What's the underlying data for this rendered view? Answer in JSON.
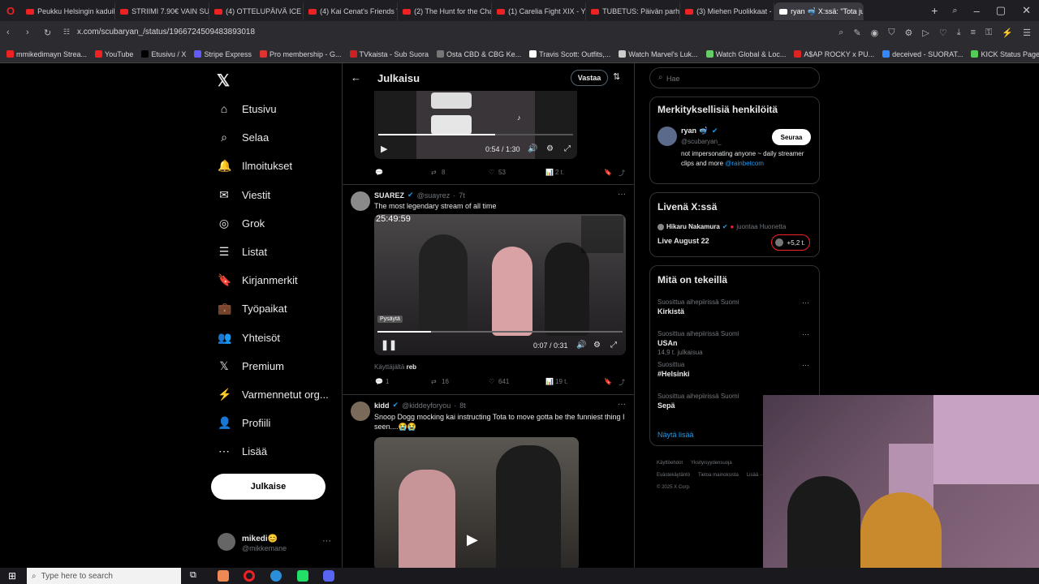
{
  "browser": {
    "tabs": [
      {
        "label": "Peukku Helsingin kaduill..."
      },
      {
        "label": "STRIIMI 7.90€ VAIN SUNN..."
      },
      {
        "label": "(4) OTTELUPÄIVÄ ICE CAG..."
      },
      {
        "label": "(4) Kai Cenat's Friends W..."
      },
      {
        "label": "(2) The Hunt for the Char..."
      },
      {
        "label": "(1) Carelia Fight XIX - You..."
      },
      {
        "label": "TUBETUS: Päivän parhaat..."
      },
      {
        "label": "(3) Miehen Puolikkaat - Yo..."
      },
      {
        "label": "ryan 🤿 X:ssä: \"Tota ju..."
      }
    ],
    "url": "x.com/scubaryan_/status/1966724509483893018",
    "bookmarks": [
      {
        "label": "mmikedimayn Strea...",
        "color": "#e22"
      },
      {
        "label": "YouTube",
        "color": "#e22"
      },
      {
        "label": "Etusivu / X",
        "color": "#000"
      },
      {
        "label": "Stripe Express",
        "color": "#635bff"
      },
      {
        "label": "Pro membership - G...",
        "color": "#d33"
      },
      {
        "label": "TVkaista - Sub Suora",
        "color": "#c22"
      },
      {
        "label": "Osta CBD & CBG Ke...",
        "color": "#777"
      },
      {
        "label": "Travis Scott: Outfits,...",
        "color": "#fff"
      },
      {
        "label": "Watch Marvel's Luk...",
        "color": "#ccc"
      },
      {
        "label": "Watch Global & Loc...",
        "color": "#6c6"
      },
      {
        "label": "A$AP ROCKY x PU...",
        "color": "#d22"
      },
      {
        "label": "deceived - SUORAT...",
        "color": "#38f"
      },
      {
        "label": "KICK Status Page",
        "color": "#5c5"
      }
    ]
  },
  "nav": {
    "items": [
      {
        "label": "Etusivu",
        "icon": "⌂"
      },
      {
        "label": "Selaa",
        "icon": "⌕"
      },
      {
        "label": "Ilmoitukset",
        "icon": "🔔"
      },
      {
        "label": "Viestit",
        "icon": "✉"
      },
      {
        "label": "Grok",
        "icon": "◎"
      },
      {
        "label": "Listat",
        "icon": "☰"
      },
      {
        "label": "Kirjanmerkit",
        "icon": "🔖"
      },
      {
        "label": "Työpaikat",
        "icon": "💼"
      },
      {
        "label": "Yhteisöt",
        "icon": "👥"
      },
      {
        "label": "Premium",
        "icon": "𝕏"
      },
      {
        "label": "Varmennetut org...",
        "icon": "⚡"
      },
      {
        "label": "Profiili",
        "icon": "👤"
      },
      {
        "label": "Lisää",
        "icon": "⋯"
      }
    ],
    "post_button": "Julkaise",
    "account": {
      "name": "mikedi😊",
      "handle": "@mikkemane"
    }
  },
  "center": {
    "header_title": "Julkaisu",
    "reply_button": "Vastaa",
    "top_video": {
      "time": "0:54 / 1:30",
      "progress": 0.6
    },
    "top_actions": {
      "retweets": "8",
      "likes": "53",
      "views": "2 t."
    },
    "post1": {
      "name": "SUAREZ",
      "handle": "@suayrez",
      "time": "7t",
      "text": "The most legendary stream of all time",
      "video_overlay": "25:49:59",
      "video_tooltip": "Pysäytä",
      "video_time": "0:07 / 0:31",
      "video_progress": 0.22,
      "from_user_prefix": "Käyttäjältä",
      "from_user": "reb",
      "replies": "1",
      "retweets": "16",
      "likes": "641",
      "views": "19 t."
    },
    "post2": {
      "name": "kidd",
      "handle": "@kiddeyforyou",
      "time": "8t",
      "text": "Snoop Dogg mocking kai instructing Tota to move  gotta be the funniest thing I seen....😭😭"
    }
  },
  "right": {
    "search_placeholder": "Hae",
    "relevant_title": "Merkityksellisiä henkilöitä",
    "relevant_user": {
      "name": "ryan 🤿",
      "handle": "@scubaryan_",
      "follow": "Seuraa",
      "bio": "not impersonating anyone ~ daily streamer clips and more",
      "bio_link": "@rainbetcom"
    },
    "live_title": "Livenä X:ssä",
    "live": {
      "host": "Hikaru Nakamura",
      "status": "juontaa Huonetta",
      "title": "Live August 22",
      "listeners": "+5,2 t."
    },
    "trends_title": "Mitä on tekeillä",
    "trends": [
      {
        "context": "Suosittua aihepiirissä Suomi",
        "name": "Kirkistä",
        "count": ""
      },
      {
        "context": "Suosittua aihepiirissä Suomi",
        "name": "USAn",
        "count": "14,9 t. julkaisua"
      },
      {
        "context": "Suosittua",
        "name": "#Helsinki",
        "count": ""
      },
      {
        "context": "Suosittua aihepiirissä Suomi",
        "name": "Sepä",
        "count": ""
      }
    ],
    "show_more": "Näytä lisää",
    "footer": [
      "Käyttöehdot",
      "Yksityisyydensuoja",
      "Evästekäytäntö",
      "Tietoa mainoksista",
      "Lisää ···",
      "© 2025 X Corp."
    ]
  },
  "taskbar": {
    "search_placeholder": "Type here to search"
  }
}
